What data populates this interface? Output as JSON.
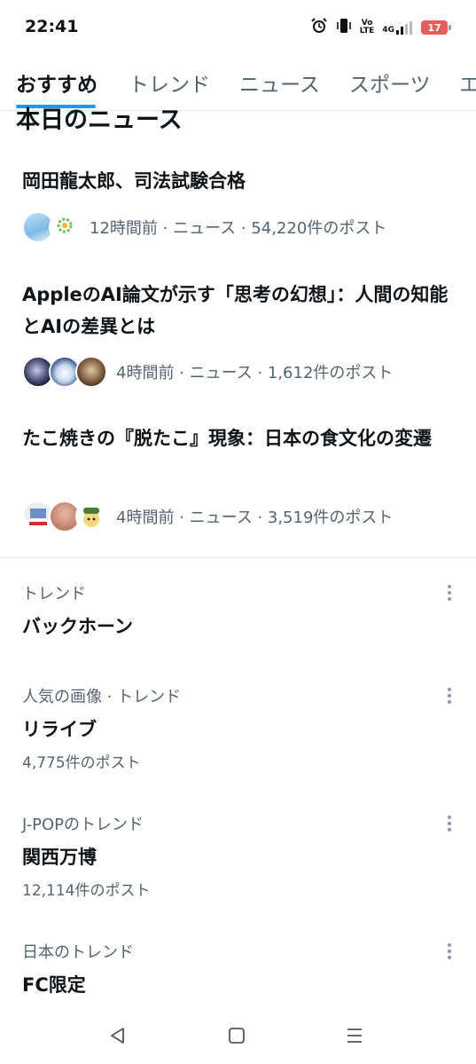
{
  "status_bar": {
    "time": "22:41",
    "volte_top": "Vo",
    "volte_bottom": "LTE",
    "network": "4G",
    "battery": "17",
    "icons": [
      "alarm-icon",
      "vibrate-icon",
      "volte-icon",
      "signal-icon",
      "battery-icon"
    ]
  },
  "tabs": [
    {
      "label": "おすすめ",
      "active": true
    },
    {
      "label": "トレンド",
      "active": false
    },
    {
      "label": "ニュース",
      "active": false
    },
    {
      "label": "スポーツ",
      "active": false
    },
    {
      "label": "エ",
      "active": false
    }
  ],
  "news_section": {
    "title": "本日のニュース",
    "items": [
      {
        "title": "岡田龍太郎、司法試験合格",
        "meta": "12時間前 · ニュース · 54,220件のポスト"
      },
      {
        "title": "AppleのAI論文が示す「思考の幻想」：人間の知能とAIの差異とは",
        "meta": "4時間前 · ニュース · 1,612件のポスト"
      },
      {
        "title": "たこ焼きの『脱たこ』現象：日本の食文化の変遷",
        "meta": "4時間前 · ニュース · 3,519件のポスト"
      }
    ]
  },
  "trends": [
    {
      "category": "トレンド",
      "name": "バックホーン",
      "count": ""
    },
    {
      "category": "人気の画像 · トレンド",
      "name": "リライブ",
      "count": "4,775件のポスト"
    },
    {
      "category": "J-POPのトレンド",
      "name": "関西万博",
      "count": "12,114件のポスト"
    },
    {
      "category": "日本のトレンド",
      "name": "FC限定",
      "count": ""
    }
  ],
  "colors": {
    "accent": "#1d9bf0",
    "secondary_text": "#536471",
    "primary_text": "#0f1419",
    "battery_low": "#e35d5b"
  },
  "navbar": {
    "icons": [
      "back-icon",
      "home-icon",
      "recents-icon"
    ]
  }
}
